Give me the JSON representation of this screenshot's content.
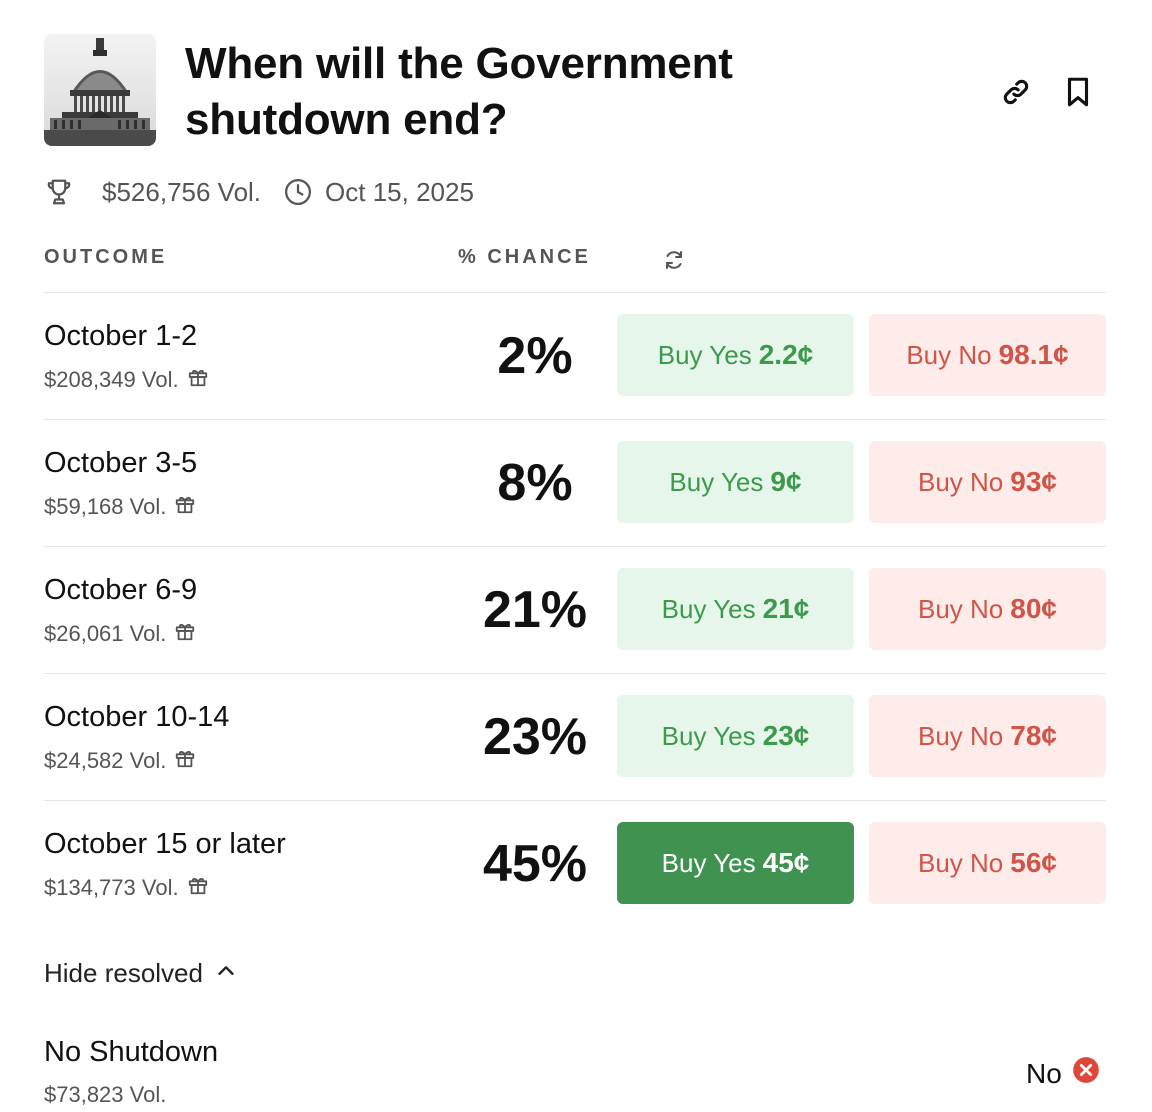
{
  "header": {
    "title": "When will the Government shutdown end?",
    "volume": "$526,756 Vol.",
    "date": "Oct 15, 2025"
  },
  "columns": {
    "outcome": "OUTCOME",
    "chance": "% CHANCE"
  },
  "outcomes": [
    {
      "name": "October 1-2",
      "volume": "$208,349 Vol.",
      "chance": "2%",
      "yes_label": "Buy Yes",
      "yes_price": "2.2¢",
      "no_label": "Buy No",
      "no_price": "98.1¢"
    },
    {
      "name": "October 3-5",
      "volume": "$59,168 Vol.",
      "chance": "8%",
      "yes_label": "Buy Yes",
      "yes_price": "9¢",
      "no_label": "Buy No",
      "no_price": "93¢"
    },
    {
      "name": "October 6-9",
      "volume": "$26,061 Vol.",
      "chance": "21%",
      "yes_label": "Buy Yes",
      "yes_price": "21¢",
      "no_label": "Buy No",
      "no_price": "80¢"
    },
    {
      "name": "October 10-14",
      "volume": "$24,582 Vol.",
      "chance": "23%",
      "yes_label": "Buy Yes",
      "yes_price": "23¢",
      "no_label": "Buy No",
      "no_price": "78¢"
    },
    {
      "name": "October 15 or later",
      "volume": "$134,773 Vol.",
      "chance": "45%",
      "yes_label": "Buy Yes",
      "yes_price": "45¢",
      "no_label": "Buy No",
      "no_price": "56¢"
    }
  ],
  "toggle": {
    "label": "Hide resolved"
  },
  "resolved": [
    {
      "name": "No Shutdown",
      "volume": "$73,823 Vol.",
      "result": "No"
    }
  ],
  "colors": {
    "yes_text": "#3c9a4d",
    "yes_bg": "#e7f6ea",
    "yes_active_bg": "#3f9250",
    "no_text": "#d05548",
    "no_bg": "#fdecea",
    "resolved_no": "#e0473b"
  },
  "icons": {
    "link": "link-icon",
    "bookmark": "bookmark-icon",
    "trophy": "trophy-icon",
    "clock": "clock-icon",
    "refresh": "refresh-icon",
    "gift": "gift-icon",
    "chevron": "chevron-up-icon",
    "resolved_no": "x-circle-icon"
  }
}
